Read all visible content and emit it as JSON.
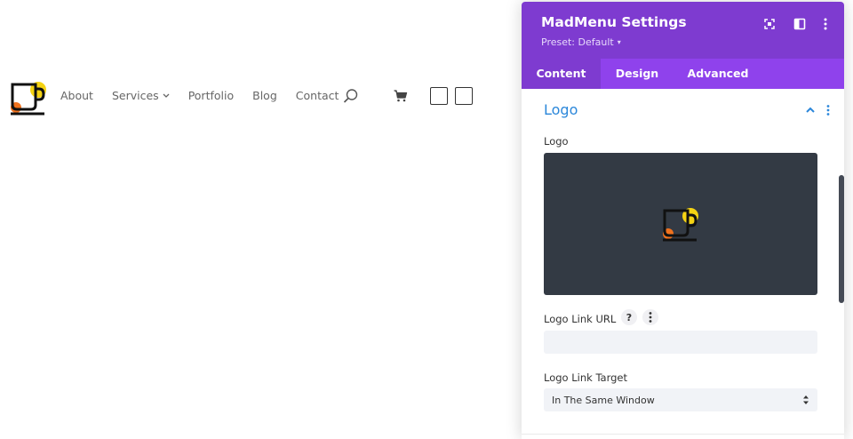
{
  "site": {
    "nav": [
      {
        "label": "About"
      },
      {
        "label": "Services"
      },
      {
        "label": "Portfolio"
      },
      {
        "label": "Blog"
      },
      {
        "label": "Contact"
      }
    ],
    "colors": {
      "logo_yellow": "#f5d313",
      "logo_orange": "#f0721e",
      "logo_stroke": "#111111"
    }
  },
  "panel": {
    "title": "MadMenu Settings",
    "preset": "Preset: Default",
    "colors": {
      "header": "#7e3bd0",
      "tabs": "#8f42ec",
      "accent": "#2b87da"
    },
    "tabs": [
      {
        "label": "Content",
        "active": true
      },
      {
        "label": "Design",
        "active": false
      },
      {
        "label": "Advanced",
        "active": false
      }
    ],
    "section": {
      "title": "Logo",
      "fields": {
        "logo_label": "Logo",
        "link_url_label": "Logo Link URL",
        "link_url_value": "",
        "help": "?",
        "link_target_label": "Logo Link Target",
        "link_target_value": "In The Same Window"
      }
    }
  }
}
